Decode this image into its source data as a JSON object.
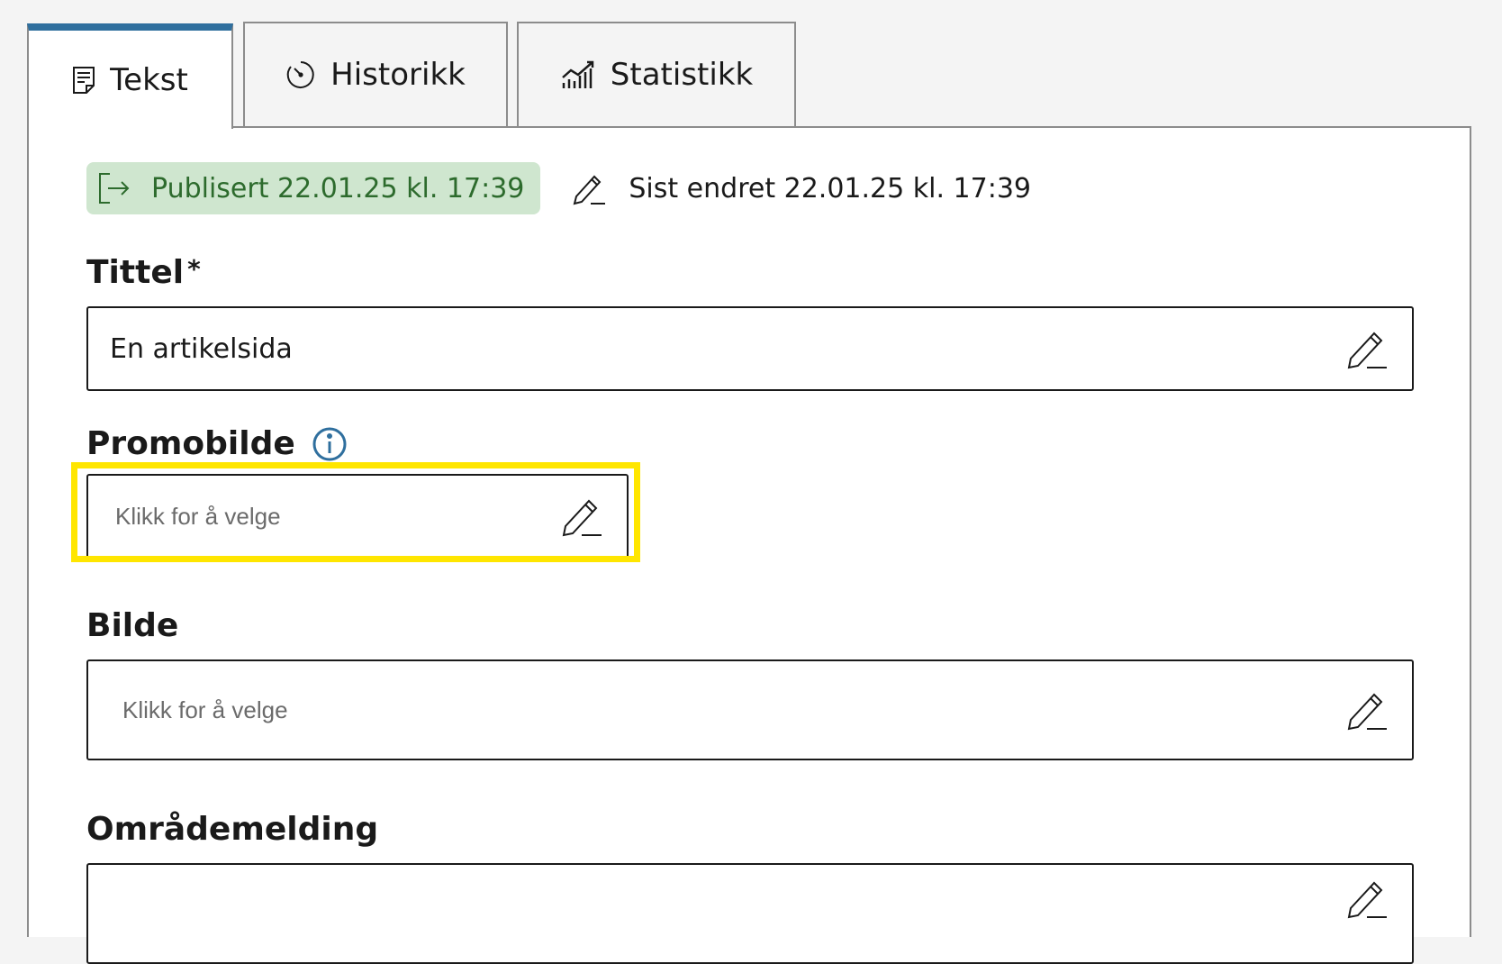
{
  "tabs": [
    {
      "label": "Tekst",
      "icon": "document-icon",
      "active": true
    },
    {
      "label": "Historikk",
      "icon": "timer-icon",
      "active": false
    },
    {
      "label": "Statistikk",
      "icon": "chart-icon",
      "active": false
    }
  ],
  "status": {
    "published": "Publisert 22.01.25 kl. 17:39",
    "edited": "Sist endret 22.01.25 kl. 17:39"
  },
  "fields": {
    "tittel": {
      "label": "Tittel",
      "required_mark": "*",
      "value": "En artikelsida"
    },
    "promobilde": {
      "label": "Promobilde",
      "placeholder": "Klikk for å velge"
    },
    "bilde": {
      "label": "Bilde",
      "placeholder": "Klikk for å velge"
    },
    "omrademelding": {
      "label": "Områdemelding",
      "value": ""
    }
  },
  "colors": {
    "active_tab_accent": "#2f6f9e",
    "published_bg": "#cfe6cf",
    "published_text": "#2d6b2d",
    "highlight": "#ffe600",
    "info_icon": "#2f6f9e"
  }
}
